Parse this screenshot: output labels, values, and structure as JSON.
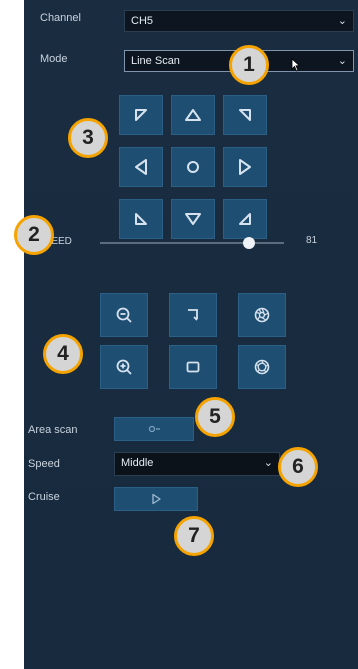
{
  "channel": {
    "label": "Channel",
    "value": "CH5"
  },
  "mode": {
    "label": "Mode",
    "value": "Line Scan"
  },
  "ptz": {
    "speed_label": "SPEED",
    "speed_value": "81",
    "speed_fraction": 0.81
  },
  "area_scan": {
    "label": "Area scan"
  },
  "speed": {
    "label": "Speed",
    "value": "Middle"
  },
  "cruise": {
    "label": "Cruise"
  },
  "callouts": [
    "1",
    "2",
    "3",
    "4",
    "5",
    "6",
    "7"
  ],
  "colors": {
    "panel": "#1a2c40",
    "button": "#1e4f73",
    "badge_border": "#f5a300",
    "badge_fill": "#d5d5d5"
  },
  "icons": {
    "dropdown": "chevron-down-icon",
    "directions": [
      "arrow-up-left-icon",
      "arrow-up-icon",
      "arrow-up-right-icon",
      "arrow-left-icon",
      "circle-home-icon",
      "arrow-right-icon",
      "arrow-down-left-icon",
      "arrow-down-icon",
      "arrow-down-right-icon"
    ],
    "lens": [
      "zoom-out-icon",
      "focus-near-icon",
      "iris-close-icon",
      "zoom-in-icon",
      "focus-far-icon",
      "iris-open-icon"
    ]
  }
}
